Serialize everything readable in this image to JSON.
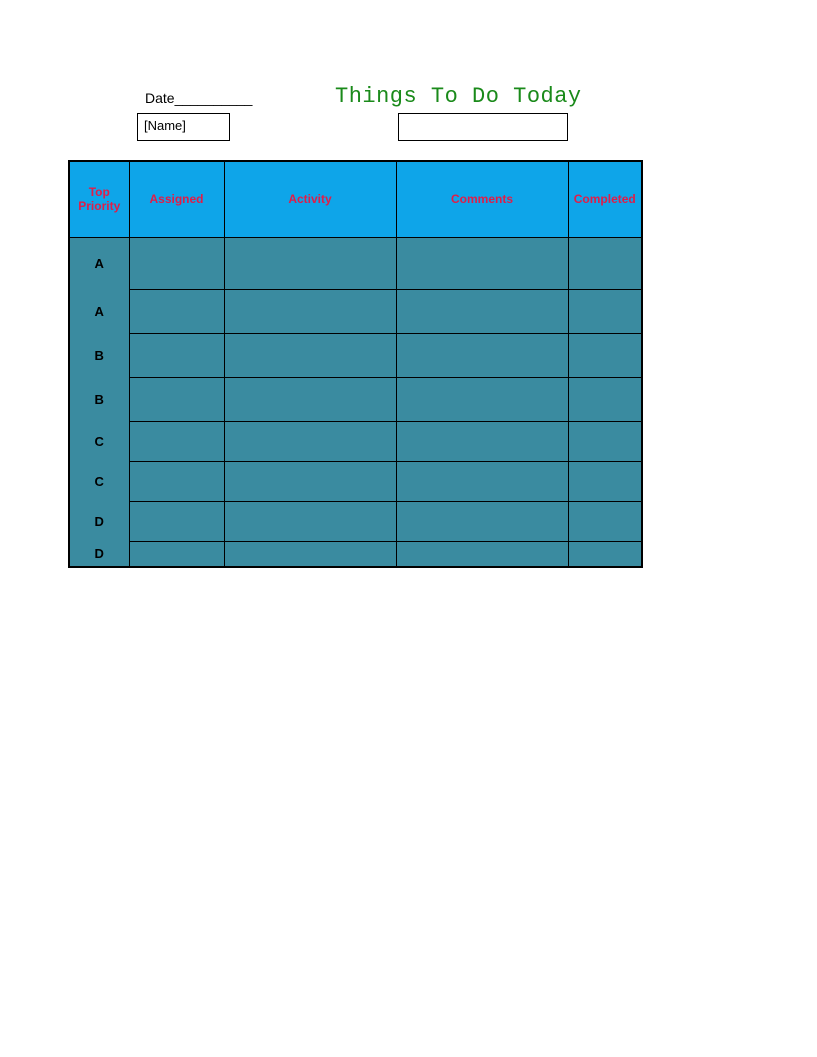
{
  "header": {
    "date_label": "Date__________",
    "title": "Things To Do Today",
    "name_placeholder": "[Name]"
  },
  "table": {
    "columns": {
      "priority": "Top Priority",
      "assigned": "Assigned",
      "activity": "Activity",
      "comments": "Comments",
      "completed": "Completed"
    },
    "rows": [
      {
        "priority": "A",
        "assigned": "",
        "activity": "",
        "comments": "",
        "completed": ""
      },
      {
        "priority": "A",
        "assigned": "",
        "activity": "",
        "comments": "",
        "completed": ""
      },
      {
        "priority": "B",
        "assigned": "",
        "activity": "",
        "comments": "",
        "completed": ""
      },
      {
        "priority": "B",
        "assigned": "",
        "activity": "",
        "comments": "",
        "completed": ""
      },
      {
        "priority": "C",
        "assigned": "",
        "activity": "",
        "comments": "",
        "completed": ""
      },
      {
        "priority": "C",
        "assigned": "",
        "activity": "",
        "comments": "",
        "completed": ""
      },
      {
        "priority": "D",
        "assigned": "",
        "activity": "",
        "comments": "",
        "completed": ""
      },
      {
        "priority": "D",
        "assigned": "",
        "activity": "",
        "comments": "",
        "completed": ""
      }
    ]
  }
}
